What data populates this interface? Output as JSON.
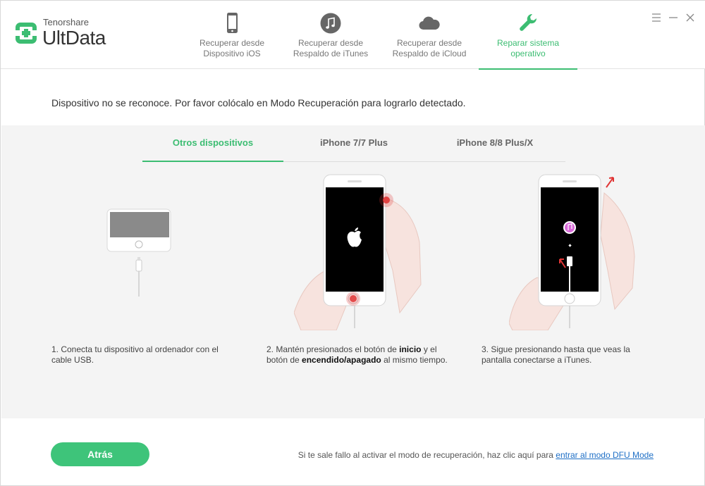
{
  "brand": {
    "company": "Tenorshare",
    "product": "UltData"
  },
  "nav_tabs": [
    {
      "label": "Recuperar desde\nDispositivo iOS",
      "icon": "phone-icon"
    },
    {
      "label": "Recuperar desde\nRespaldo de iTunes",
      "icon": "music-note-icon"
    },
    {
      "label": "Recuperar desde\nRespaldo de iCloud",
      "icon": "cloud-icon"
    },
    {
      "label": "Reparar sistema\noperativo",
      "icon": "wrench-icon",
      "active": true
    }
  ],
  "message": "Dispositivo no se reconoce. Por favor colócalo en Modo Recuperación para lograrlo detectado.",
  "subtabs": [
    {
      "label": "Otros dispositivos",
      "active": true
    },
    {
      "label": "iPhone 7/7 Plus"
    },
    {
      "label": "iPhone 8/8 Plus/X"
    }
  ],
  "steps": [
    {
      "text": "1. Conecta tu dispositivo al ordenador con el cable USB."
    },
    {
      "pre": "2. Mantén presionados el botón de ",
      "b1": "inicio",
      "mid": " y el botón de ",
      "b2": "encendido/apagado",
      "post": " al mismo tiempo."
    },
    {
      "text": "3. Sigue presionando hasta que veas la pantalla conectarse a iTunes."
    }
  ],
  "footer": {
    "back_label": "Atrás",
    "note": "Si te sale fallo al activar el modo de recuperación, haz clic aquí para ",
    "link": "entrar al modo DFU Mode"
  },
  "colors": {
    "accent": "#3cbd72",
    "link": "#1e6fc6",
    "panel": "#f4f4f4"
  }
}
